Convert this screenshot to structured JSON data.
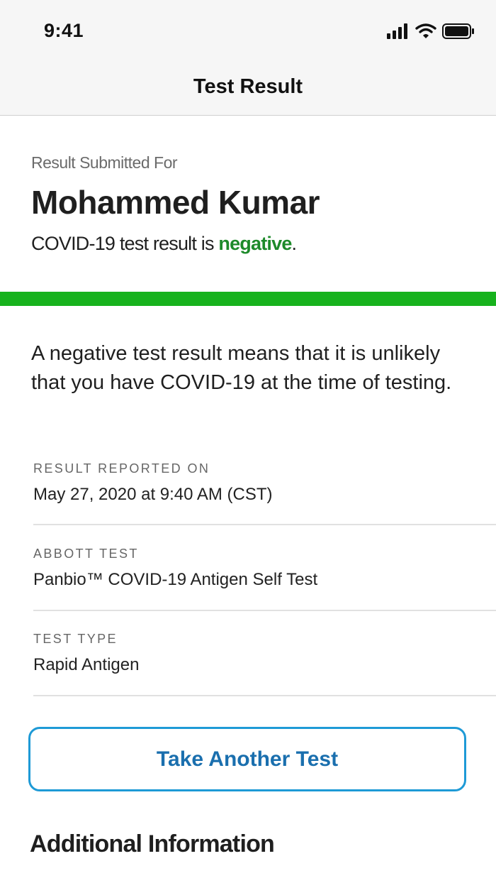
{
  "status_bar": {
    "time": "9:41",
    "icons": [
      "cellular-signal-icon",
      "wifi-icon",
      "battery-icon"
    ]
  },
  "nav": {
    "title": "Test Result"
  },
  "result": {
    "submitted_label": "Result Submitted For",
    "patient_name": "Mohammed Kumar",
    "line_prefix": "COVID-19 test result is ",
    "value": "negative",
    "line_suffix": ".",
    "status_color": "#17b21d",
    "explanation": "A negative test result means that it is unlikely that you have COVID-19 at the time of testing."
  },
  "details": [
    {
      "label": "RESULT REPORTED ON",
      "value": "May 27, 2020 at 9:40 AM (CST)"
    },
    {
      "label": "ABBOTT TEST",
      "value": "Panbio™ COVID-19 Antigen Self Test"
    },
    {
      "label": "TEST TYPE",
      "value": "Rapid Antigen"
    }
  ],
  "actions": {
    "take_another_test": "Take Another Test"
  },
  "sections": {
    "additional_info": "Additional Information"
  },
  "colors": {
    "accent": "#1e9ad6",
    "button_text": "#1a6fae",
    "negative_text": "#1d8a2a"
  }
}
